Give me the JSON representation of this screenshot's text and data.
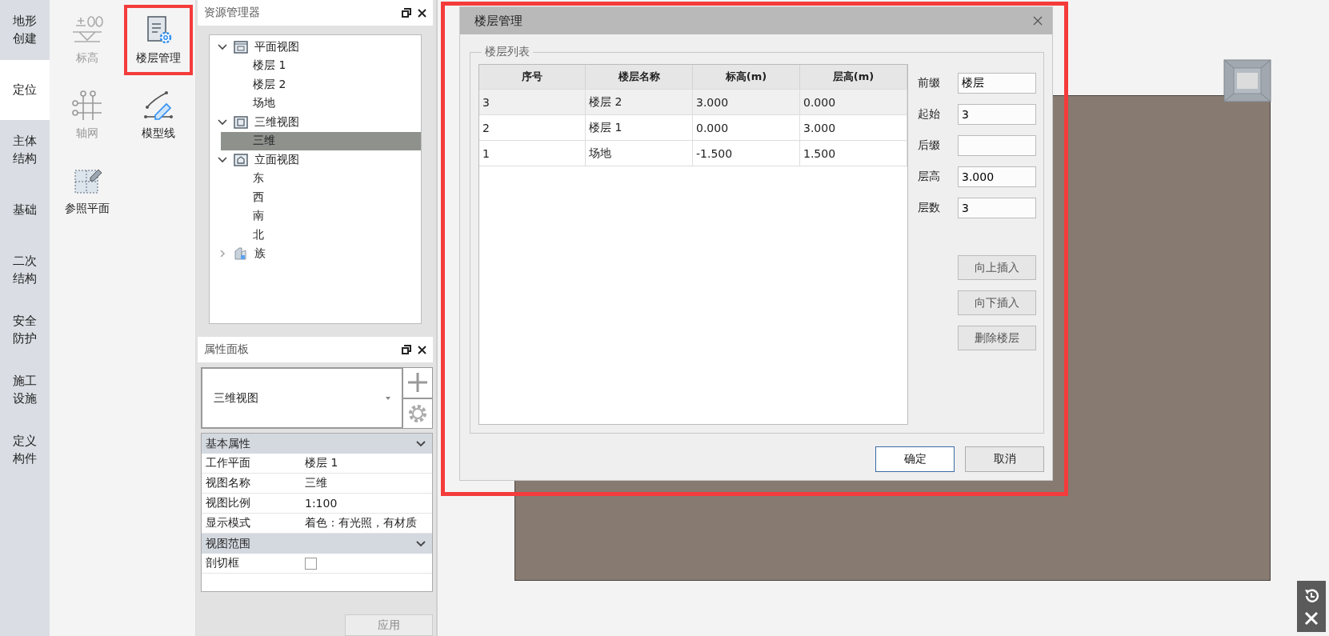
{
  "category_tabs": [
    {
      "label": "地形创建",
      "selected": false
    },
    {
      "label": "定位",
      "selected": true
    },
    {
      "label": "主体结构",
      "selected": false
    },
    {
      "label": "基础",
      "selected": false
    },
    {
      "label": "二次结构",
      "selected": false
    },
    {
      "label": "安全防护",
      "selected": false
    },
    {
      "label": "施工设施",
      "selected": false
    },
    {
      "label": "定义构件",
      "selected": false
    }
  ],
  "ribbon_tools": [
    {
      "label": "标高",
      "kind": "level",
      "disabled": true,
      "highlighted": false
    },
    {
      "label": "楼层管理",
      "kind": "floors",
      "disabled": false,
      "highlighted": true
    },
    {
      "label": "轴网",
      "kind": "grid",
      "disabled": true,
      "highlighted": false
    },
    {
      "label": "模型线",
      "kind": "modelline",
      "disabled": false,
      "highlighted": false
    },
    {
      "label": "参照平面",
      "kind": "refplane",
      "disabled": false,
      "highlighted": false
    }
  ],
  "resource_manager": {
    "title": "资源管理器",
    "tree": [
      {
        "label": "平面视图",
        "kind": "plan",
        "expanded": true,
        "selected": false,
        "children": [
          {
            "label": "楼层 1",
            "selected": false
          },
          {
            "label": "楼层 2",
            "selected": false
          },
          {
            "label": "场地",
            "selected": false
          }
        ]
      },
      {
        "label": "三维视图",
        "kind": "perspective",
        "expanded": true,
        "selected": false,
        "children": [
          {
            "label": "三维",
            "selected": true
          }
        ]
      },
      {
        "label": "立面视图",
        "kind": "elevation",
        "expanded": true,
        "selected": false,
        "children": [
          {
            "label": "东",
            "selected": false
          },
          {
            "label": "西",
            "selected": false
          },
          {
            "label": "南",
            "selected": false
          },
          {
            "label": "北",
            "selected": false
          }
        ]
      },
      {
        "label": "族",
        "kind": "family",
        "expanded": false,
        "selected": false
      }
    ]
  },
  "properties_panel": {
    "title": "属性面板",
    "type_selector": "三维视图",
    "sections": [
      {
        "title": "基本属性",
        "expanded": true,
        "rows": [
          {
            "name": "工作平面",
            "value": "楼层 1"
          },
          {
            "name": "视图名称",
            "value": "三维"
          },
          {
            "name": "视图比例",
            "value": "1:100"
          },
          {
            "name": "显示模式",
            "value": "着色：有光照，有材质"
          }
        ]
      },
      {
        "title": "视图范围",
        "expanded": true,
        "rows": [
          {
            "name": "剖切框",
            "kind": "checkbox",
            "checked": false
          }
        ]
      }
    ],
    "apply_button": {
      "label": "应用",
      "disabled": true
    }
  },
  "dialog": {
    "title": "楼层管理",
    "highlighted": true,
    "group_title": "楼层列表",
    "table": {
      "columns": [
        "序号",
        "楼层名称",
        "标高(m)",
        "层高(m)"
      ],
      "rows": [
        {
          "cells": [
            "3",
            "楼层 2",
            "3.000",
            "0.000"
          ],
          "selected": true
        },
        {
          "cells": [
            "2",
            "楼层 1",
            "0.000",
            "3.000"
          ],
          "selected": false
        },
        {
          "cells": [
            "1",
            "场地",
            "-1.500",
            "1.500"
          ],
          "selected": false
        }
      ]
    },
    "fields": [
      {
        "label": "前缀",
        "value": "楼层"
      },
      {
        "label": "起始",
        "value": "3"
      },
      {
        "label": "后缀"
      },
      {
        "label": "层高",
        "value": "3.000"
      },
      {
        "label": "层数",
        "value": "3"
      }
    ],
    "actions": [
      {
        "label": "向上插入"
      },
      {
        "label": "向下插入"
      },
      {
        "label": "删除楼层"
      }
    ],
    "footer_buttons": [
      {
        "label": "确定",
        "default": true
      },
      {
        "label": "取消",
        "default": false
      }
    ]
  }
}
